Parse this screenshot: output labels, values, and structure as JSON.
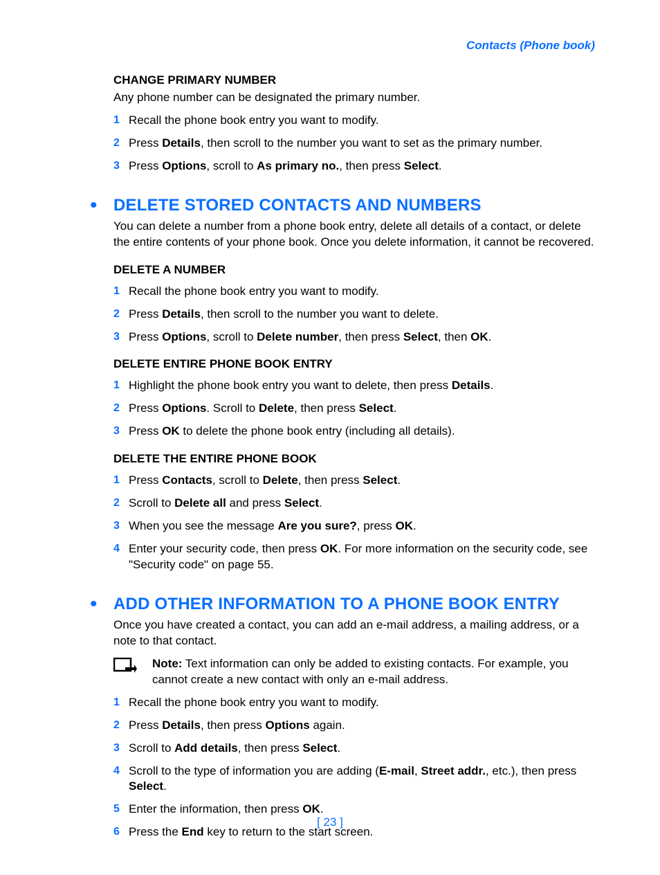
{
  "header": "Contacts (Phone book)",
  "s1": {
    "title": "CHANGE PRIMARY NUMBER",
    "intro": "Any phone number can be designated the primary number.",
    "steps": [
      "Recall the phone book entry you want to modify.",
      "Press <b>Details</b>, then scroll to the number you want to set as the primary number.",
      "Press <b>Options</b>, scroll to <b>As primary no.</b>, then press <b>Select</b>."
    ]
  },
  "s2": {
    "title": "DELETE STORED CONTACTS AND NUMBERS",
    "intro": "You can delete a number from a phone book entry, delete all details of a contact, or delete the entire contents of your phone book. Once you delete information, it cannot be recovered.",
    "sub1": {
      "title": "DELETE A NUMBER",
      "steps": [
        "Recall the phone book entry you want to modify.",
        "Press <b>Details</b>, then scroll to the number you want to delete.",
        "Press <b>Options</b>, scroll to <b>Delete number</b>, then press <b>Select</b>, then <b>OK</b>."
      ]
    },
    "sub2": {
      "title": "DELETE ENTIRE PHONE BOOK ENTRY",
      "steps": [
        "Highlight the phone book entry you want to delete, then press <b>Details</b>.",
        "Press <b>Options</b>. Scroll to <b>Delete</b>, then press <b>Select</b>.",
        "Press <b>OK</b> to delete the phone book entry (including all details)."
      ]
    },
    "sub3": {
      "title": "DELETE THE ENTIRE PHONE BOOK",
      "steps": [
        "Press <b>Contacts</b>, scroll to <b>Delete</b>, then press <b>Select</b>.",
        "Scroll to <b>Delete all</b> and press <b>Select</b>.",
        "When you see the message <b>Are you sure?</b>, press <b>OK</b>.",
        "Enter your security code, then press <b>OK</b>. For more information on the security code, see \"Security code\" on page 55."
      ]
    }
  },
  "s3": {
    "title": "ADD OTHER INFORMATION TO A PHONE BOOK ENTRY",
    "intro": "Once you have created a contact, you can add an e-mail address, a mailing address, or a note to that contact.",
    "note": "<b>Note:</b> Text information can only be added to existing contacts. For example, you cannot create a new contact with only an e-mail address.",
    "steps": [
      "Recall the phone book entry you want to modify.",
      "Press <b>Details</b>, then press <b>Options</b> again.",
      "Scroll to <b>Add details</b>, then press <b>Select</b>.",
      "Scroll to the type of information you are adding (<b>E-mail</b>, <b>Street addr.</b>, etc.), then press <b>Select</b>.",
      "Enter the information, then press <b>OK</b>.",
      "Press the <b>End</b> key to return to the start screen."
    ]
  },
  "footer": "[ 23 ]"
}
